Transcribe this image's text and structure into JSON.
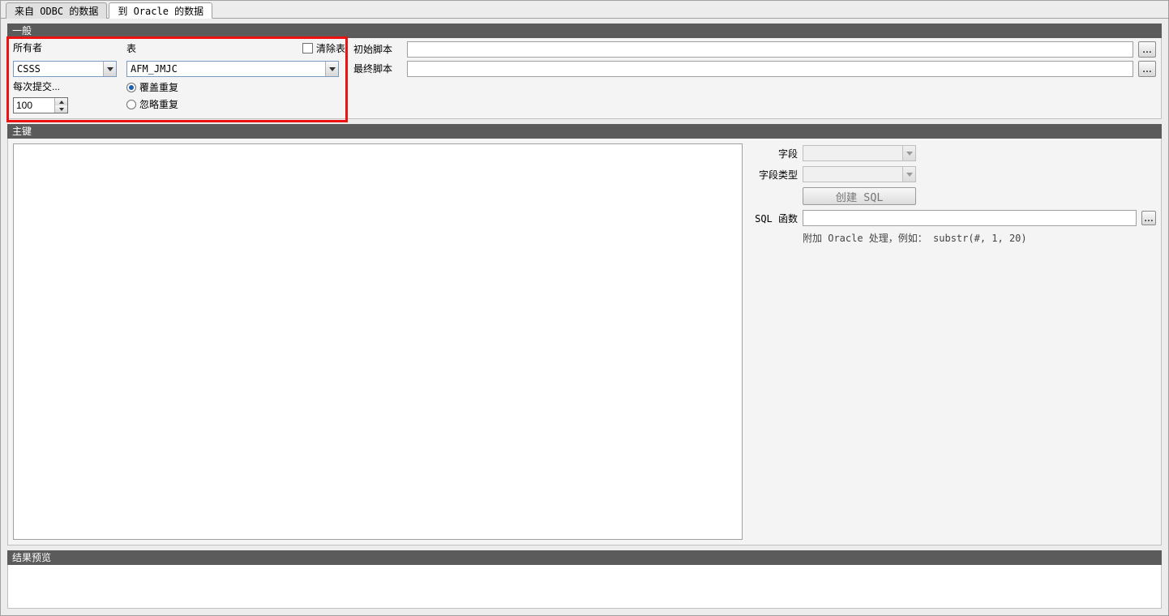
{
  "tabs": {
    "from_odbc": "来自 ODBC 的数据",
    "to_oracle": "到 Oracle 的数据"
  },
  "sections": {
    "general": "一般",
    "advanced": "主键",
    "result_preview": "结果预览"
  },
  "general": {
    "owner_label": "所有者",
    "owner_value": "CSSS",
    "table_label": "表",
    "table_value": "AFM_JMJC",
    "clear_table_label": "清除表",
    "commit_label": "每次提交...",
    "commit_value": "100",
    "dup_overwrite_label": "覆盖重复",
    "dup_ignore_label": "忽略重复",
    "initial_script_label": "初始脚本",
    "final_script_label": "最终脚本"
  },
  "right": {
    "field_label": "字段",
    "field_type_label": "字段类型",
    "create_sql_btn": "创建 SQL",
    "sql_func_label": "SQL 函数",
    "hint": "附加 Oracle 处理，例如：  substr(#, 1, 20)"
  },
  "glyphs": {
    "dots": "…"
  }
}
